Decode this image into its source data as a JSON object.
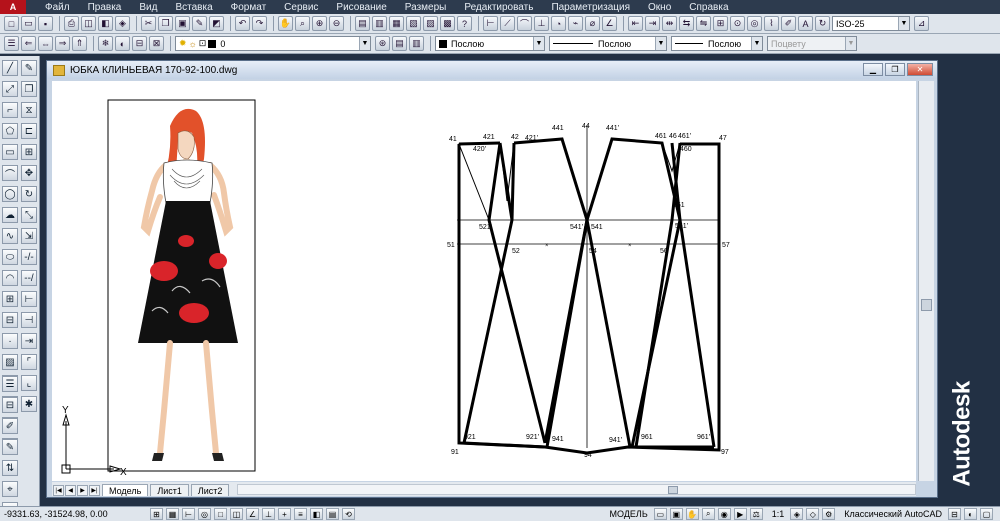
{
  "menu": {
    "items": [
      "Файл",
      "Правка",
      "Вид",
      "Вставка",
      "Формат",
      "Сервис",
      "Рисование",
      "Размеры",
      "Редактировать",
      "Параметризация",
      "Окно",
      "Справка"
    ]
  },
  "toolbar": {
    "dimstyle": "ISO-25",
    "layer": "0",
    "color": "Послою",
    "linetype": "Послою",
    "lineweight": "Послою",
    "plotstyle": "Поцвету"
  },
  "document": {
    "title": "ЮБКА КЛИНЬЕВАЯ 170-92-100.dwg",
    "tabs": [
      "Модель",
      "Лист1",
      "Лист2"
    ],
    "active_tab": "Модель"
  },
  "drawing": {
    "ucs_labels": {
      "y": "Y",
      "x": "X"
    },
    "points": {
      "p41": "41",
      "p421": "421",
      "p42": "42",
      "p421p": "421'",
      "p420": "420'",
      "p441": "441",
      "p44": "44",
      "p441p": "441'",
      "p461": "461",
      "p46": "46",
      "p461p": "461'",
      "p460": "460",
      "p47": "47",
      "p521p": "521'",
      "p541p": "541'",
      "p541": "541",
      "p561": "561",
      "p561p": "561'",
      "p51": "51",
      "p52": "52",
      "p54": "54",
      "p56": "56",
      "p57": "57",
      "p921": "921",
      "p921p": "921'",
      "p941": "941",
      "p941p": "941'",
      "p961": "961",
      "p961p": "961'",
      "p91": "91",
      "p94": "94",
      "p97": "97"
    }
  },
  "brand": "Autodesk",
  "status": {
    "coords": "-9331.63, -31524.98, 0.00",
    "model": "МОДЕЛЬ",
    "scale": "1:1",
    "workspace": "Классический AutoCAD"
  },
  "colors": {
    "app_bg": "#223044",
    "canvas": "#ffffff",
    "skirt_black": "#111111",
    "flower_red": "#d9242a",
    "hair": "#e2512a"
  }
}
